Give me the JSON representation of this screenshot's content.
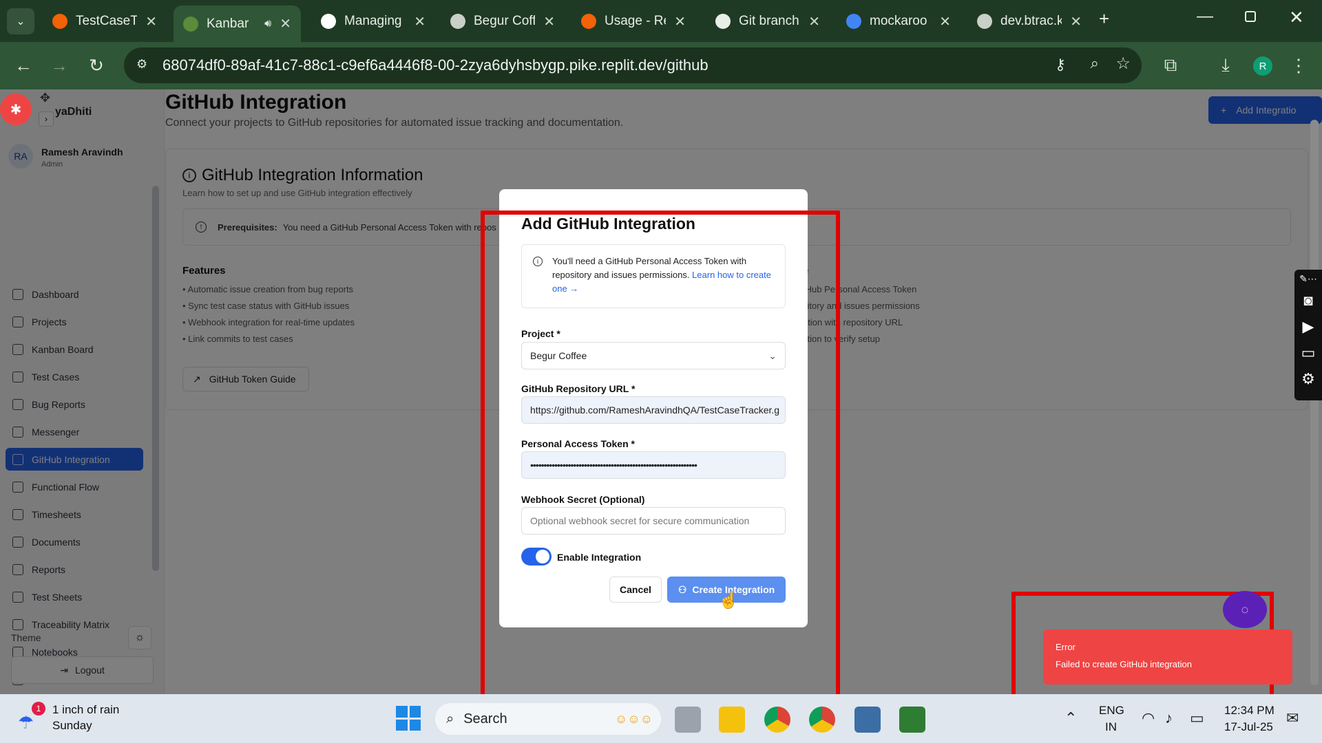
{
  "browser": {
    "tabs": [
      {
        "title": "TestCaseTr",
        "icon": "replit-icon",
        "color": "#f26207"
      },
      {
        "title": "Kanbar",
        "icon": "kanban-icon",
        "color": "#5b8c3a"
      },
      {
        "title": "Managing",
        "icon": "github-icon",
        "color": "#ffffff"
      },
      {
        "title": "Begur Coff",
        "icon": "globe-icon",
        "color": "#c8d0c8"
      },
      {
        "title": "Usage - Re",
        "icon": "replit-icon",
        "color": "#f26207"
      },
      {
        "title": "Git branch",
        "icon": "openai-icon",
        "color": "#e8eee8"
      },
      {
        "title": "mockaroo",
        "icon": "google-icon",
        "color": "#4285f4"
      },
      {
        "title": "dev.btrac.k",
        "icon": "globe-icon",
        "color": "#c8d0c8"
      }
    ],
    "url": "68074df0-89af-41c7-88c1-c9ef6a4446f8-00-2zya6dyhsbygp.pike.replit.dev/github",
    "profile_initial": "R"
  },
  "app": {
    "brand": "yaDhiti",
    "user": {
      "initials": "RA",
      "name": "Ramesh Aravindh",
      "role": "Admin"
    },
    "nav": [
      {
        "label": "Dashboard",
        "icon": "dashboard-icon"
      },
      {
        "label": "Projects",
        "icon": "folder-icon"
      },
      {
        "label": "Kanban Board",
        "icon": "kanban-icon"
      },
      {
        "label": "Test Cases",
        "icon": "checkbox-icon"
      },
      {
        "label": "Bug Reports",
        "icon": "bug-icon"
      },
      {
        "label": "Messenger",
        "icon": "terminal-icon"
      },
      {
        "label": "GitHub Integration",
        "icon": "github-icon"
      },
      {
        "label": "Functional Flow",
        "icon": "flow-icon"
      },
      {
        "label": "Timesheets",
        "icon": "clock-icon"
      },
      {
        "label": "Documents",
        "icon": "document-icon"
      },
      {
        "label": "Reports",
        "icon": "report-icon"
      },
      {
        "label": "Test Sheets",
        "icon": "sheet-icon"
      },
      {
        "label": "Traceability Matrix",
        "icon": "matrix-icon"
      },
      {
        "label": "Notebooks",
        "icon": "notebook-icon"
      },
      {
        "label": "Todo List",
        "icon": "todo-icon"
      }
    ],
    "active_nav": "GitHub Integration",
    "theme_label": "Theme",
    "logout_label": "Logout"
  },
  "page": {
    "title": "GitHub Integration",
    "subtitle": "Connect your projects to GitHub repositories for automated issue tracking and documentation.",
    "add_button": "Add Integratio",
    "info_title": "GitHub Integration Information",
    "info_subtitle": "Learn how to set up and use GitHub integration effectively",
    "prereq_bold": "Prerequisites:",
    "prereq_text": "You need a GitHub Personal Access Token with repos",
    "features_title": "Features",
    "features": [
      "• Automatic issue creation from bug reports",
      "• Sync test case status with GitHub issues",
      "• Webhook integration for real-time updates",
      "• Link commits to test cases"
    ],
    "setup_title_partial": "e",
    "setup": [
      "tHub Personal Access Token",
      "sitory and issues permissions",
      "ation with repository URL",
      "ction to verify setup"
    ],
    "guide_button": "GitHub Token Guide"
  },
  "modal": {
    "title": "Add GitHub Integration",
    "notice": "You'll need a GitHub Personal Access Token with repository and issues permissions.",
    "notice_link": "Learn how to create one →",
    "project_label": "Project *",
    "project_value": "Begur Coffee",
    "repo_label": "GitHub Repository URL *",
    "repo_value": "https://github.com/RameshAravindhQA/TestCaseTracker.g",
    "token_label": "Personal Access Token *",
    "token_value": "••••••••••••••••••••••••••••••••••••••••••••••••••••••••••••••",
    "webhook_label": "Webhook Secret (Optional)",
    "webhook_placeholder": "Optional webhook secret for secure communication",
    "enable_label": "Enable Integration",
    "enabled": true,
    "cancel": "Cancel",
    "create": "Create Integration"
  },
  "toast": {
    "title": "Error",
    "message": "Failed to create GitHub integration",
    "color": "#ef4444"
  },
  "taskbar": {
    "weather_badge": "1",
    "weather_line1": "1 inch of rain",
    "weather_line2": "Sunday",
    "search_label": "Search",
    "lang1": "ENG",
    "lang2": "IN",
    "time": "12:34 PM",
    "date": "17-Jul-25"
  }
}
